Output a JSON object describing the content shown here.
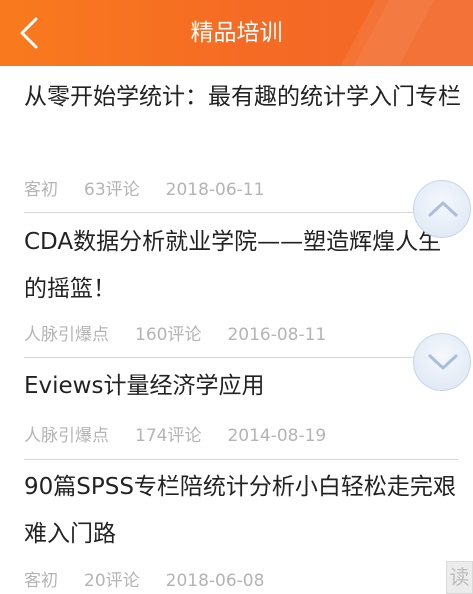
{
  "header": {
    "title": "精品培训",
    "back_icon": "chevron-left-icon",
    "background_color": "#f57322"
  },
  "articles": [
    {
      "title": "从零开始学统计：最有趣的统计学入门专栏",
      "author": "客初",
      "comments": "63评论",
      "date": "2018-06-11"
    },
    {
      "title": "CDA数据分析就业学院——塑造辉煌人生的摇篮！",
      "author": "人脉引爆点",
      "comments": "160评论",
      "date": "2016-08-11"
    },
    {
      "title": "Eviews计量经济学应用",
      "author": "人脉引爆点",
      "comments": "174评论",
      "date": "2014-08-19"
    },
    {
      "title": "90篇SPSS专栏陪统计分析小白轻松走完艰难入门路",
      "author": "客初",
      "comments": "20评论",
      "date": "2018-06-08"
    }
  ],
  "scroll_buttons": {
    "up_icon": "chevron-up-icon",
    "down_icon": "chevron-down-icon"
  },
  "corner_badge": {
    "text": "读"
  }
}
